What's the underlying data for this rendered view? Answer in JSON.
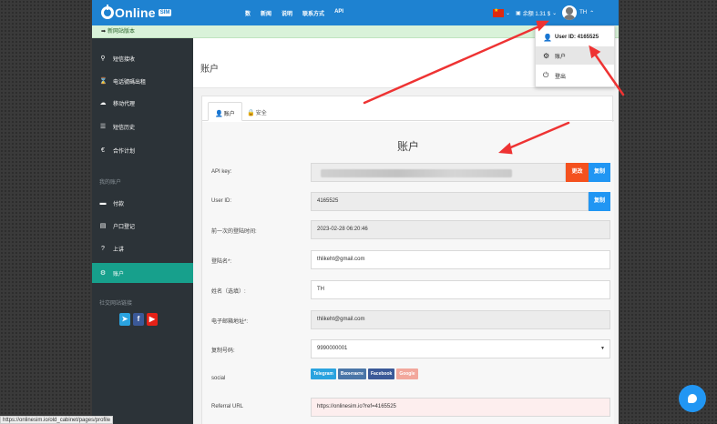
{
  "topbar": {
    "logo_text": "Online",
    "logo_badge": "SIM",
    "nav": [
      "数",
      "新闻",
      "说明",
      "联系方式",
      "API"
    ],
    "balance_text": "余额 1.31 $",
    "username": "TH",
    "colors": {
      "primary": "#1e82d1"
    }
  },
  "notice": {
    "text": "新网站版本"
  },
  "sidebar": {
    "items_top": [
      {
        "icon": "receive-sms-icon",
        "label": "短信接收"
      },
      {
        "icon": "hourglass-icon",
        "label": "电话號碼出租"
      },
      {
        "icon": "cloud-icon",
        "label": "移动代理"
      },
      {
        "icon": "list-icon",
        "label": "短信历史"
      },
      {
        "icon": "euro-icon",
        "label": "合作计划"
      }
    ],
    "section_account": "我的账户",
    "items_account": [
      {
        "icon": "payment-icon",
        "label": "付款"
      },
      {
        "icon": "file-icon",
        "label": "户口登记"
      },
      {
        "icon": "question-icon",
        "label": "上讲"
      },
      {
        "icon": "gear-icon",
        "label": "账户",
        "active": true
      }
    ],
    "section_social": "社交网站链接",
    "active_color": "#17a08c"
  },
  "main": {
    "page_title": "账户",
    "tabs": [
      {
        "label": "账户",
        "active": true
      },
      {
        "label": "安全",
        "active": false
      }
    ],
    "form_title": "账户",
    "fields": {
      "api_key": {
        "label": "API key:",
        "value": "",
        "btn_change": "更改",
        "btn_copy": "复制"
      },
      "user_id": {
        "label": "User ID:",
        "value": "4165525",
        "btn_copy": "复制"
      },
      "last_login": {
        "label": "前一次的登陆时间:",
        "value": "2023-02-28 06:20:46"
      },
      "login": {
        "label": "登陆名*:",
        "value": "thlikeht@gmail.com"
      },
      "name": {
        "label": "姓名（选填）:",
        "value": "TH"
      },
      "email": {
        "label": "电子邮箱地址*:",
        "value": "thlikeht@gmail.com"
      },
      "copy_number": {
        "label": "复制号码:",
        "value": "9990000001"
      },
      "social": {
        "label": "social",
        "buttons": [
          "Telegram",
          "Вконтакте",
          "Facebook",
          "Google"
        ]
      },
      "referral": {
        "label": "Referral URL",
        "value": "https://onlinesim.io?ref=4165525"
      }
    }
  },
  "dropdown": {
    "user_id_label": "User ID: 4165525",
    "account": "账户",
    "logout": "登出"
  },
  "statusbar": {
    "url": "https://onlinesim.io/old_cabinet/pages/profile"
  }
}
